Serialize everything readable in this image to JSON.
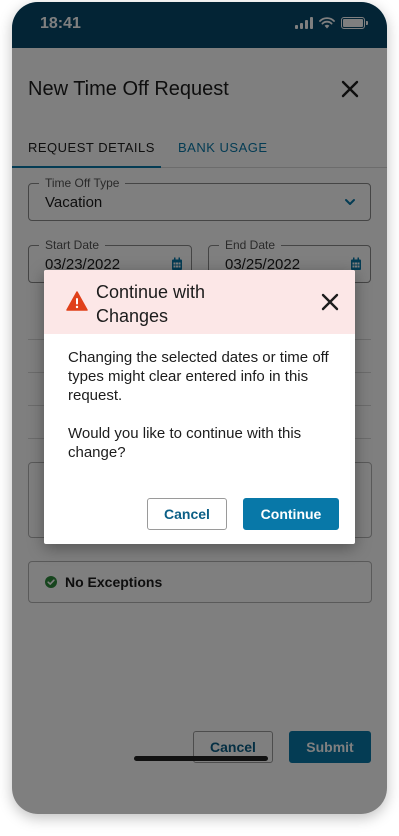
{
  "status_bar": {
    "time": "18:41"
  },
  "page": {
    "title": "New Time Off Request",
    "tabs": [
      {
        "label": "REQUEST DETAILS",
        "active": true
      },
      {
        "label": "BANK USAGE",
        "active": false
      }
    ]
  },
  "form": {
    "time_off_type": {
      "label": "Time Off Type",
      "value": "Vacation"
    },
    "start_date": {
      "label": "Start Date",
      "value": "03/23/2022"
    },
    "end_date": {
      "label": "End Date",
      "value": "03/25/2022"
    }
  },
  "exceptions": {
    "label": "No Exceptions",
    "icon": "check-circle-icon"
  },
  "footer": {
    "cancel_label": "Cancel",
    "submit_label": "Submit"
  },
  "dialog": {
    "title_line1": "Continue with",
    "title_line2": "Changes",
    "icon": "warning-icon",
    "message": "Changing the selected dates or time off types might clear entered info in this request.",
    "question": "Would you like to continue with this change?",
    "cancel_label": "Cancel",
    "continue_label": "Continue"
  },
  "colors": {
    "status_bar": "#06486a",
    "accent": "#0878a8",
    "dialog_header": "#fce7e7",
    "warning": "#e0401a",
    "success": "#2e8b3d"
  }
}
